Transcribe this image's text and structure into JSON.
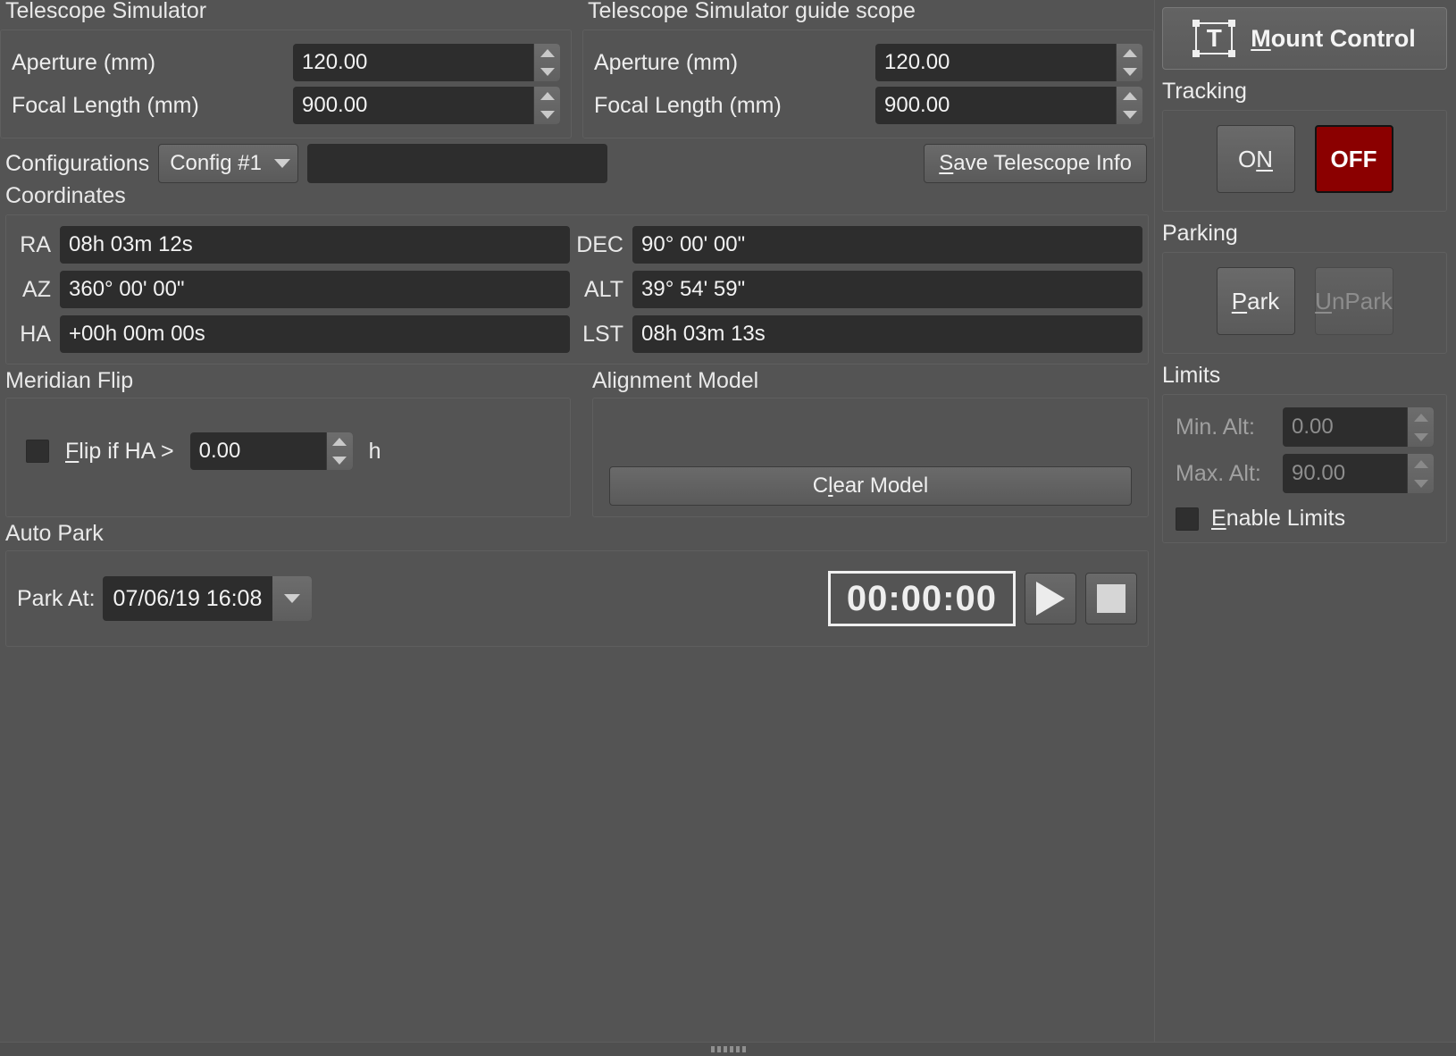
{
  "scopes": [
    {
      "title": "Telescope Simulator",
      "fields": [
        {
          "label": "Aperture (mm)",
          "value": "120.00"
        },
        {
          "label": "Focal Length (mm)",
          "value": "900.00"
        }
      ]
    },
    {
      "title": "Telescope Simulator guide scope",
      "fields": [
        {
          "label": "Aperture (mm)",
          "value": "120.00"
        },
        {
          "label": "Focal Length (mm)",
          "value": "900.00"
        }
      ]
    }
  ],
  "configurations": {
    "label": "Configurations",
    "selected": "Config #1",
    "name_value": "",
    "save_button": {
      "prefix": "S",
      "rest": "ave Telescope Info"
    }
  },
  "coordinates": {
    "title": "Coordinates",
    "rows": [
      {
        "left_label": "RA",
        "left_value": "08h 03m 12s",
        "right_label": "DEC",
        "right_value": "90° 00' 00\""
      },
      {
        "left_label": "AZ",
        "left_value": " 360° 00' 00\"",
        "right_label": "ALT",
        "right_value": " 39° 54' 59\""
      },
      {
        "left_label": "HA",
        "left_value": "+00h 00m 00s",
        "right_label": "LST",
        "right_value": "08h 03m 13s"
      }
    ]
  },
  "meridian_flip": {
    "title": "Meridian Flip",
    "checkbox_label": {
      "prefix": "F",
      "rest": "lip if HA >"
    },
    "checked": false,
    "value": "0.00",
    "unit": "h"
  },
  "alignment_model": {
    "title": "Alignment Model",
    "clear_button": {
      "pre": "C",
      "mid": "l",
      "post": "ear  Model"
    }
  },
  "auto_park": {
    "title": "Auto Park",
    "park_at_label": "Park At:",
    "park_at_value": "07/06/19 16:08",
    "timer_value": "00:00:00",
    "play_icon": "play-icon",
    "stop_icon": "stop-icon"
  },
  "sidebar": {
    "mount_control": {
      "icon": "telescope-t-icon",
      "prefix": "M",
      "rest": "ount Control"
    },
    "tracking": {
      "title": "Tracking",
      "on": {
        "pre": "O",
        "mid": "N"
      },
      "off": "OFF",
      "active": "OFF",
      "off_color": "#8b0000"
    },
    "parking": {
      "title": "Parking",
      "park": {
        "pre": "P",
        "rest": "ark"
      },
      "unpark": {
        "pre": "U",
        "rest": "nPark"
      },
      "unpark_disabled": true
    },
    "limits": {
      "title": "Limits",
      "min_label": "Min. Alt:",
      "min_value": "0.00",
      "max_label": "Max. Alt:",
      "max_value": "90.00",
      "enable": {
        "pre": "E",
        "rest": "nable Limits"
      },
      "enabled": false
    }
  }
}
